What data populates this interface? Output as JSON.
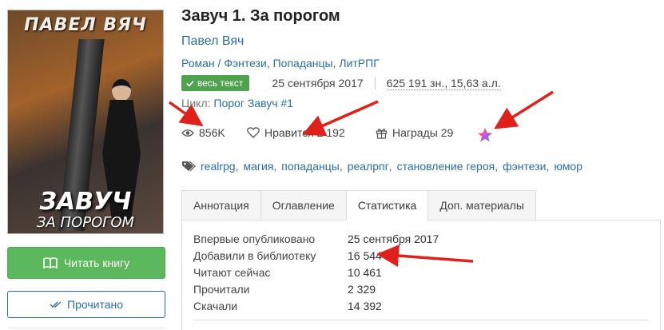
{
  "cover": {
    "author_text": "ПАВЕЛ ВЯЧ",
    "title_text": "ЗАВУЧ",
    "subtitle_text": "ЗА ПОРОГОМ"
  },
  "actions": {
    "read_label": "Читать книгу",
    "read_icon": "open-book-icon",
    "done_label": "Прочитано",
    "done_icon": "double-check-icon"
  },
  "book": {
    "title": "Завуч 1. За порогом",
    "author": "Павел Вяч",
    "genres": [
      "Роман",
      "Фэнтези",
      "Попаданцы",
      "ЛитРПГ"
    ],
    "genre_prefix": "Роман / ",
    "status_badge": "весь текст",
    "date": "25 сентября 2017",
    "size": "625 191 зн., 15,63 а.л.",
    "cycle_label": "Цикл: ",
    "cycle_name": "Порог Завуч #1"
  },
  "stats": {
    "views": "856K",
    "likes": "Нравится 2 192",
    "awards": "Награды 29"
  },
  "tags": [
    "realrpg",
    "магия",
    "попаданцы",
    "реалрпг",
    "становление героя",
    "фэнтези",
    "юмор"
  ],
  "tabs": [
    {
      "label": "Аннотация",
      "active": false
    },
    {
      "label": "Оглавление",
      "active": false
    },
    {
      "label": "Статистика",
      "active": true
    },
    {
      "label": "Доп. материалы",
      "active": false
    }
  ],
  "statistics": [
    {
      "label": "Впервые опубликовано",
      "value": "25 сентября 2017"
    },
    {
      "label": "Добавили в библиотеку",
      "value": "16 544"
    },
    {
      "label": "Читают сейчас",
      "value": "10 461"
    },
    {
      "label": "Прочитали",
      "value": "2 329"
    },
    {
      "label": "Скачали",
      "value": "14 392"
    }
  ],
  "colors": {
    "link": "#2a6ea6",
    "read_button": "#5cb85c",
    "badge": "#4fa34f",
    "annotation_arrows": "#e0201b"
  }
}
